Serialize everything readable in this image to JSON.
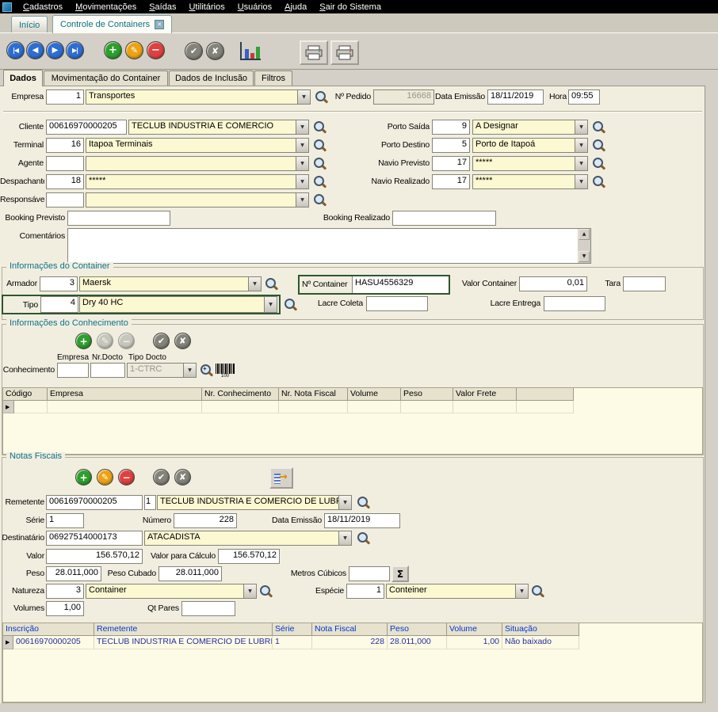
{
  "colors": {
    "accent_teal": "#0d7288",
    "highlight_green": "#2d572d",
    "grid_header_blue": "#0636cc",
    "grid_row_navy": "#20309c"
  },
  "icons": {
    "close_tab": "✕",
    "first": "|◀",
    "prev": "◀",
    "next": "▶",
    "last": "▶|",
    "add": "+",
    "edit": "✎",
    "delete": "−",
    "confirm": "✔",
    "cancel": "✘",
    "sigma": "Σ",
    "transfer_arrow": "→",
    "barcode_caption": "100"
  },
  "menu": {
    "items": [
      "Cadastros",
      "Movimentações",
      "Saídas",
      "Utilitários",
      "Usuários",
      "Ajuda",
      "Sair do Sistema"
    ]
  },
  "window_tabs": {
    "inicio": "Início",
    "controle": "Controle de Containers"
  },
  "form_tabs": {
    "dados": "Dados",
    "movimentacao": "Movimentação do Container",
    "inclusao": "Dados de Inclusão",
    "filtros": "Filtros"
  },
  "header_row": {
    "empresa": {
      "label": "Empresa",
      "code": "1",
      "name": "Transportes"
    },
    "pedido": {
      "label": "Nº Pedido",
      "value": "16668"
    },
    "data_emissao": {
      "label": "Data Emissão",
      "value": "18/11/2019"
    },
    "hora": {
      "label": "Hora",
      "value": "09:55"
    }
  },
  "main": {
    "cliente": {
      "label": "Cliente",
      "code": "00616970000205",
      "name": "TECLUB INDUSTRIA E COMERCIO"
    },
    "terminal": {
      "label": "Terminal",
      "code": "16",
      "name": "Itapoa Terminais"
    },
    "agente": {
      "label": "Agente",
      "code": "",
      "name": ""
    },
    "despachante": {
      "label": "Despachante",
      "code": "18",
      "name": "*****"
    },
    "responsavel": {
      "label": "Responsável",
      "code": "",
      "name": ""
    },
    "porto_saida": {
      "label": "Porto Saída",
      "code": "9",
      "name": "A Designar"
    },
    "porto_destino": {
      "label": "Porto Destino",
      "code": "5",
      "name": "Porto de Itapoá"
    },
    "navio_previsto": {
      "label": "Navio Previsto",
      "code": "17",
      "name": "*****"
    },
    "navio_realizado": {
      "label": "Navio Realizado",
      "code": "17",
      "name": "*****"
    },
    "booking_previsto": {
      "label": "Booking Previsto",
      "value": ""
    },
    "booking_realizado": {
      "label": "Booking Realizado",
      "value": ""
    },
    "comentarios": {
      "label": "Comentários",
      "value": ""
    }
  },
  "container_info": {
    "title": "Informações do Container",
    "armador": {
      "label": "Armador",
      "code": "3",
      "name": "Maersk"
    },
    "numero_container": {
      "label": "Nº Container",
      "value": "HASU4556329"
    },
    "valor_container": {
      "label": "Valor Container",
      "value": "0,01"
    },
    "tara": {
      "label": "Tara",
      "value": ""
    },
    "tipo": {
      "label": "Tipo",
      "code": "4",
      "name": "Dry 40 HC"
    },
    "lacre_coleta": {
      "label": "Lacre Coleta",
      "value": ""
    },
    "lacre_entrega": {
      "label": "Lacre Entrega",
      "value": ""
    }
  },
  "conhecimento": {
    "title": "Informações do Conhecimento",
    "mini_labels": {
      "empresa": "Empresa",
      "nr_docto": "Nr.Docto",
      "tipo_docto": "Tipo Docto"
    },
    "row_label": "Conhecimento",
    "empresa_value": "",
    "nr_docto_value": "",
    "tipo_docto_value": "1-CTRC",
    "grid": {
      "headers": [
        "Código",
        "Empresa",
        "Nr. Conhecimento",
        "Nr. Nota Fiscal",
        "Volume",
        "Peso",
        "Valor Frete"
      ]
    }
  },
  "notas_fiscais": {
    "title": "Notas Fiscais",
    "remetente": {
      "label": "Remetente",
      "code": "00616970000205",
      "seq": "1",
      "name": "TECLUB INDUSTRIA E COMERCIO DE LUBRIF"
    },
    "serie": {
      "label": "Série",
      "value": "1"
    },
    "numero": {
      "label": "Número",
      "value": "228"
    },
    "data_emissao": {
      "label": "Data Emissão",
      "value": "18/11/2019"
    },
    "destinatario": {
      "label": "Destinatário",
      "code": "06927514000173",
      "name": "ATACADISTA"
    },
    "valor": {
      "label": "Valor",
      "value": "156.570,12"
    },
    "valor_calculo": {
      "label": "Valor para Cálculo",
      "value": "156.570,12"
    },
    "peso": {
      "label": "Peso",
      "value": "28.011,000"
    },
    "peso_cubado": {
      "label": "Peso Cubado",
      "value": "28.011,000"
    },
    "metros_cubicos": {
      "label": "Metros Cúbicos",
      "value": ""
    },
    "natureza": {
      "label": "Natureza",
      "code": "3",
      "name": "Container"
    },
    "especie": {
      "label": "Espécie",
      "code": "1",
      "name": "Conteiner"
    },
    "volumes": {
      "label": "Volumes",
      "value": "1,00"
    },
    "qt_pares": {
      "label": "Qt Pares",
      "value": ""
    },
    "grid": {
      "headers": [
        "Inscrição",
        "Remetente",
        "Série",
        "Nota Fiscal",
        "Peso",
        "Volume",
        "Situação"
      ],
      "row": {
        "inscricao": "00616970000205",
        "remetente": "TECLUB INDUSTRIA E COMERCIO DE LUBRIF",
        "serie": "1",
        "nota_fiscal": "228",
        "peso": "28.011,000",
        "volume": "1,00",
        "situacao": "Não baixado"
      }
    }
  }
}
